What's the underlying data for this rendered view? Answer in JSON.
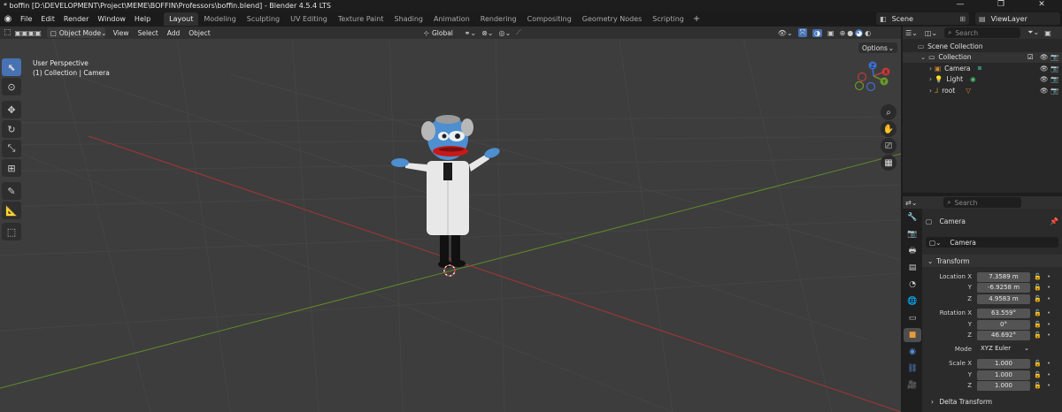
{
  "window": {
    "title": "* boffin [D:\\DEVELOPMENT\\Project\\MEME\\BOFFIN\\Professors\\boffin.blend] - Blender 4.5.4 LTS",
    "minimize": "—",
    "maximize": "❐",
    "close": "✕"
  },
  "menu": {
    "file": "File",
    "edit": "Edit",
    "render": "Render",
    "window": "Window",
    "help": "Help"
  },
  "workspaces": [
    "Layout",
    "Modeling",
    "Sculpting",
    "UV Editing",
    "Texture Paint",
    "Shading",
    "Animation",
    "Rendering",
    "Compositing",
    "Geometry Nodes",
    "Scripting"
  ],
  "active_workspace": "Layout",
  "scene": {
    "name": "Scene",
    "view_layer": "ViewLayer"
  },
  "viewport_header": {
    "mode": "Object Mode",
    "view": "View",
    "select": "Select",
    "add": "Add",
    "object": "Object",
    "orientation": "Global",
    "options": "Options"
  },
  "viewport": {
    "perspective": "User Perspective",
    "collection_info": "(1) Collection | Camera",
    "gizmo": {
      "x": "X",
      "y": "Y",
      "z": "Z"
    }
  },
  "outliner": {
    "search_placeholder": "Search",
    "scene_collection": "Scene Collection",
    "collection": "Collection",
    "items": [
      {
        "name": "Camera",
        "color": "#d08a2e"
      },
      {
        "name": "Light",
        "color": "#d08a2e"
      },
      {
        "name": "root",
        "color": "#d08a2e"
      }
    ]
  },
  "properties": {
    "search_placeholder": "Search",
    "object_name": "Camera",
    "data_name": "Camera",
    "transform_label": "Transform",
    "location": {
      "label": "Location X",
      "x": "7.3589 m",
      "y": "-6.9258 m",
      "z": "4.9583 m"
    },
    "rotation": {
      "label": "Rotation X",
      "x": "63.559°",
      "y": "0°",
      "z": "46.692°"
    },
    "mode": {
      "label": "Mode",
      "value": "XYZ Euler"
    },
    "scale": {
      "label": "Scale X",
      "x": "1.000",
      "y": "1.000",
      "z": "1.000"
    },
    "axis_y": "Y",
    "axis_z": "Z",
    "delta_transform": "Delta Transform"
  },
  "colors": {
    "accent": "#4772b3",
    "x_axis": "#c23a3a",
    "y_axis": "#6a9a2a",
    "grid": "#4a4a4a"
  }
}
